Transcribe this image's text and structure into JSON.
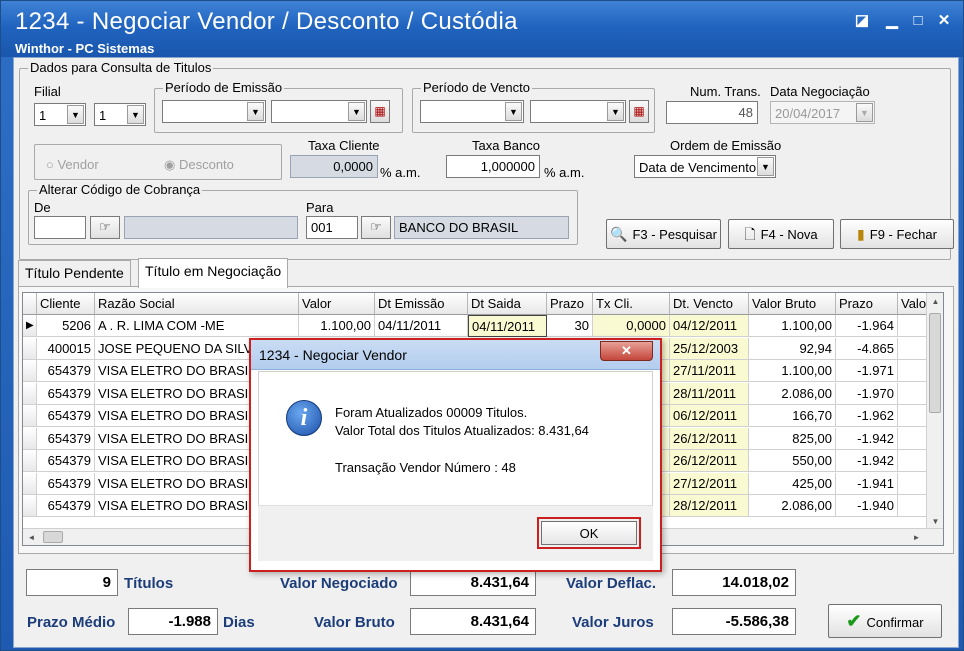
{
  "window": {
    "title": "1234 - Negociar Vendor / Desconto / Custódia",
    "subtitle": "Winthor - PC Sistemas",
    "controls": {
      "restore": "◪",
      "minimize": "▁",
      "maximize": "□",
      "close": "✕"
    }
  },
  "consulta": {
    "group_label": "Dados para Consulta de Titulos",
    "filial_label": "Filial",
    "filial_value1": "1",
    "filial_value2": "1",
    "emissao_label": "Período de Emissão",
    "vencto_label": "Período de Vencto",
    "num_trans_label": "Num. Trans.",
    "num_trans_value": "48",
    "data_negociacao_label": "Data Negociação",
    "data_negociacao_value": "20/04/2017",
    "radio_vendor": "Vendor",
    "radio_desconto": "Desconto",
    "taxa_cliente_label": "Taxa Cliente",
    "taxa_cliente_value": "0,0000",
    "taxa_cliente_unit": "% a.m.",
    "taxa_banco_label": "Taxa Banco",
    "taxa_banco_value": "1,000000",
    "taxa_banco_unit": "% a.m.",
    "ordem_label": "Ordem de Emissão",
    "ordem_value": "Data de Vencimento",
    "cobranca_label": "Alterar Código de Cobrança",
    "de_label": "De",
    "para_label": "Para",
    "para_code": "001",
    "para_desc": "BANCO DO BRASIL"
  },
  "buttons": {
    "pesquisar": "F3 - Pesquisar",
    "nova": "F4 - Nova",
    "fechar": "F9 - Fechar",
    "confirmar": "Confirmar"
  },
  "tabs": [
    "Título Pendente",
    "Título em Negociação"
  ],
  "grid": {
    "columns": [
      "Cliente",
      "Razão Social",
      "Valor",
      "Dt Emissão",
      "Dt Saida",
      "Prazo",
      "Tx Cli.",
      "Dt. Vencto",
      "Valor Bruto",
      "Prazo",
      "Valo"
    ],
    "rows": [
      {
        "cliente": "5206",
        "razao": "A . R. LIMA COM -ME",
        "valor": "1.100,00",
        "emissao": "04/11/2011",
        "saida": "04/11/2011",
        "prazo": "30",
        "txcli": "0,0000",
        "vencto": "04/12/2011",
        "bruto": "1.100,00",
        "prazo2": "-1.964"
      },
      {
        "cliente": "400015",
        "razao": "JOSE PEQUENO DA SILVA",
        "vencto": "25/12/2003",
        "bruto": "92,94",
        "prazo2": "-4.865"
      },
      {
        "cliente": "654379",
        "razao": "VISA ELETRO DO BRASIL",
        "vencto": "27/11/2011",
        "bruto": "1.100,00",
        "prazo2": "-1.971"
      },
      {
        "cliente": "654379",
        "razao": "VISA ELETRO DO BRASIL",
        "vencto": "28/11/2011",
        "bruto": "2.086,00",
        "prazo2": "-1.970"
      },
      {
        "cliente": "654379",
        "razao": "VISA ELETRO DO BRASIL",
        "vencto": "06/12/2011",
        "bruto": "166,70",
        "prazo2": "-1.962"
      },
      {
        "cliente": "654379",
        "razao": "VISA ELETRO DO BRASIL",
        "vencto": "26/12/2011",
        "bruto": "825,00",
        "prazo2": "-1.942"
      },
      {
        "cliente": "654379",
        "razao": "VISA ELETRO DO BRASIL",
        "vencto": "26/12/2011",
        "bruto": "550,00",
        "prazo2": "-1.942"
      },
      {
        "cliente": "654379",
        "razao": "VISA ELETRO DO BRASIL",
        "vencto": "27/12/2011",
        "bruto": "425,00",
        "prazo2": "-1.941"
      },
      {
        "cliente": "654379",
        "razao": "VISA ELETRO DO BRASIL",
        "vencto": "28/12/2011",
        "bruto": "2.086,00",
        "prazo2": "-1.940"
      }
    ]
  },
  "totals": {
    "titulos_value": "9",
    "titulos_label": "Títulos",
    "valor_negociado_label": "Valor Negociado",
    "valor_negociado_value": "8.431,64",
    "valor_deflac_label": "Valor Deflac.",
    "valor_deflac_value": "14.018,02",
    "prazo_medio_label": "Prazo Médio",
    "prazo_medio_value": "-1.988",
    "dias_label": "Dias",
    "valor_bruto_label": "Valor Bruto",
    "valor_bruto_value": "8.431,64",
    "valor_juros_label": "Valor Juros",
    "valor_juros_value": "-5.586,38"
  },
  "dialog": {
    "title": "1234 - Negociar Vendor",
    "close": "✕",
    "line1": "Foram Atualizados 00009 Titulos.",
    "line2": "Valor Total dos Titulos Atualizados: 8.431,64",
    "line3": "Transação Vendor Número : 48",
    "ok": "OK"
  }
}
